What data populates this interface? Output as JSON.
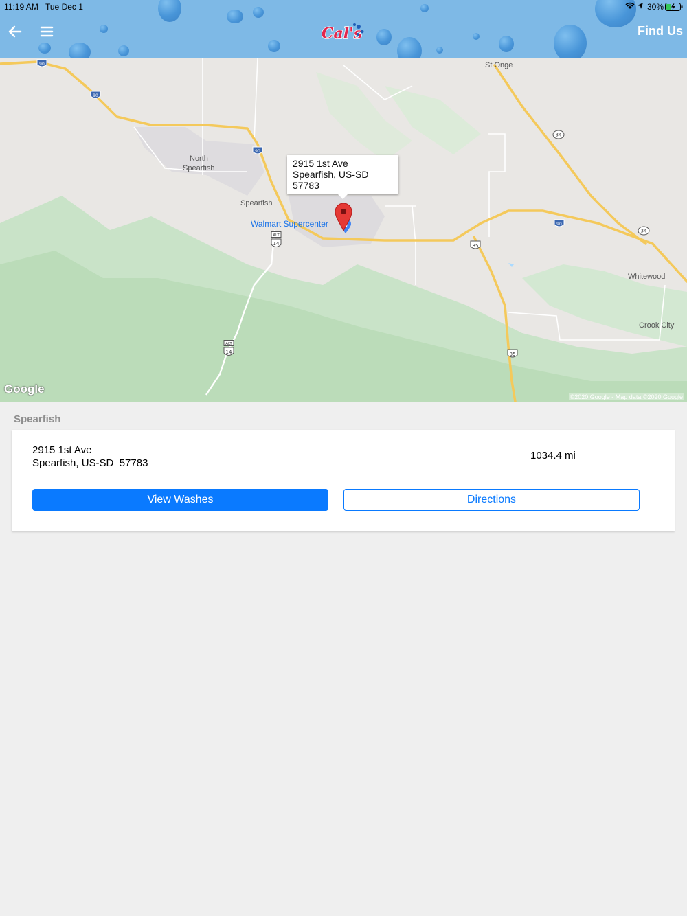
{
  "status_bar": {
    "time": "11:19 AM",
    "date": "Tue Dec 1",
    "battery": "30%"
  },
  "header": {
    "logo_text": "Cal's",
    "title": "Find Us"
  },
  "map": {
    "labels": {
      "st_onge": "St Onge",
      "north_spearfish_1": "North",
      "north_spearfish_2": "Spearfish",
      "spearfish": "Spearfish",
      "walmart": "Walmart Supercenter",
      "whitewood": "Whitewood",
      "crook_city": "Crook City"
    },
    "shields": {
      "i90": "90",
      "us85": "85",
      "sr34": "34",
      "alt14": "14",
      "alt": "ALT"
    },
    "popup": {
      "line1": "2915 1st Ave",
      "line2": "Spearfish, US-SD",
      "line3": "57783"
    },
    "google_logo": "Google",
    "copyright": "©2020 Google - Map data ©2020 Google"
  },
  "location": {
    "section_title": "Spearfish",
    "address_line1": "2915 1st Ave",
    "address_line2": "Spearfish, US-SD  57783",
    "distance": "1034.4 mi",
    "view_washes_label": "View Washes",
    "directions_label": "Directions"
  },
  "colors": {
    "header_bg": "#7eb9e6",
    "accent": "#0a7aff",
    "pin": "#e53935"
  }
}
